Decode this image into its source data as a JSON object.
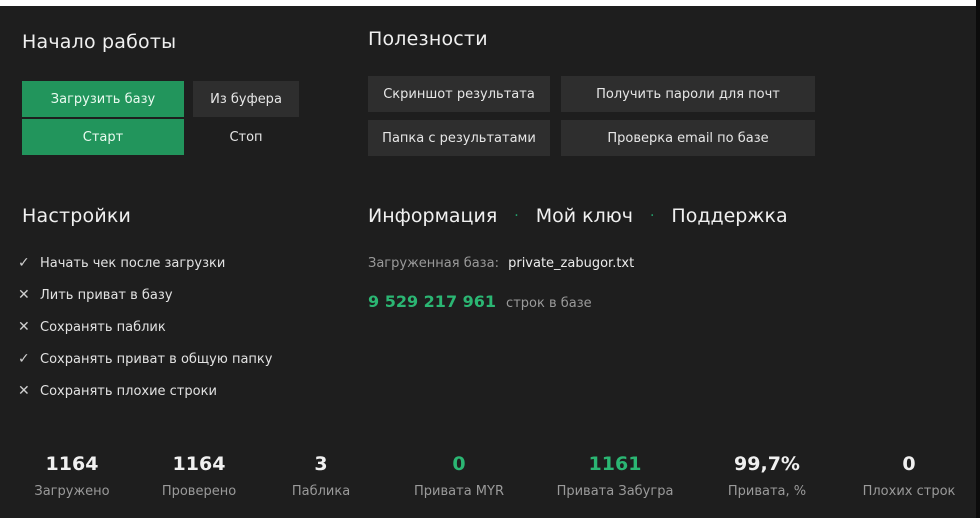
{
  "start_section": {
    "title": "Начало работы",
    "load_base": "Загрузить базу",
    "from_buffer": "Из буфера",
    "start": "Старт",
    "stop": "Стоп"
  },
  "utilities": {
    "title": "Полезности",
    "screenshot": "Скриншот результата",
    "get_passwords": "Получить пароли для почт",
    "results_folder": "Папка с результатами",
    "check_email": "Проверка email по базе"
  },
  "settings": {
    "title": "Настройки",
    "options": [
      {
        "mark": "✓",
        "label": "Начать чек после загрузки",
        "checked": true
      },
      {
        "mark": "✕",
        "label": "Лить приват в базу",
        "checked": false
      },
      {
        "mark": "✕",
        "label": "Сохранять паблик",
        "checked": false
      },
      {
        "mark": "✓",
        "label": "Сохранять приват в общую папку",
        "checked": true
      },
      {
        "mark": "✕",
        "label": "Сохранять плохие строки",
        "checked": false
      }
    ]
  },
  "info": {
    "tab_info": "Информация",
    "tab_key": "Мой ключ",
    "tab_support": "Поддержка",
    "separator": "·",
    "loaded_label": "Загруженная база:",
    "loaded_file": "private_zabugor.txt",
    "rows_count": "9 529 217 961",
    "rows_label": "строк в базе"
  },
  "stats": [
    {
      "value": "1164",
      "label": "Загружено"
    },
    {
      "value": "1164",
      "label": "Проверено"
    },
    {
      "value": "3",
      "label": "Паблика"
    },
    {
      "value": "0",
      "label": "Привата MYR"
    },
    {
      "value": "1161",
      "label": "Привата Забугра"
    },
    {
      "value": "99,7%",
      "label": "Привата, %"
    },
    {
      "value": "0",
      "label": "Плохих строк"
    }
  ],
  "colors": {
    "accent": "#22955c",
    "highlight": "#2bb673",
    "background": "#1e1e1e"
  }
}
